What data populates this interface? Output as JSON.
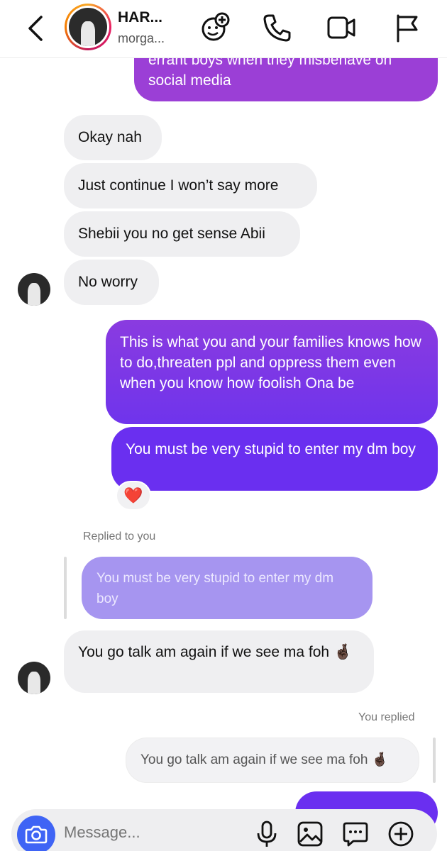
{
  "header": {
    "name": "HAR...",
    "username": "morga...",
    "icons": [
      "back-arrow-icon",
      "add-people-icon",
      "phone-icon",
      "video-icon",
      "flag-icon"
    ]
  },
  "messages": {
    "partial_top_line1": "errant boys when they misbehave on",
    "partial_top_line2": "social media",
    "in1": "Okay nah",
    "in2": "Just continue I won’t say more",
    "in3": "Shebii you no get sense Abii",
    "in4": "No worry",
    "out1": "This is what you and your families knows how to do,threaten ppl and oppress them even when you know how foolish Ona be",
    "out2": "You must be very stupid to enter my dm boy",
    "reaction": "❤️",
    "replied_label": "Replied to you",
    "quoted": "You must be very stupid to enter my dm boy",
    "in5": "You go talk am again if we see ma foh 🤞🏿",
    "you_replied_label": "You replied",
    "quoted_own": "You go talk am again if we see ma foh 🤞🏿"
  },
  "composer": {
    "placeholder": "Message...",
    "icons": [
      "camera-icon",
      "microphone-icon",
      "gallery-icon",
      "sticker-icon",
      "plus-icon"
    ]
  },
  "colors": {
    "accent_camera": "#3f64f5",
    "bubble_purple_top": "#9b3fd6",
    "bubble_purple": "#7a36e8",
    "bubble_violet": "#6b2ff0",
    "quoted_bg": "#a695f0",
    "incoming_bg": "#efeff1"
  }
}
